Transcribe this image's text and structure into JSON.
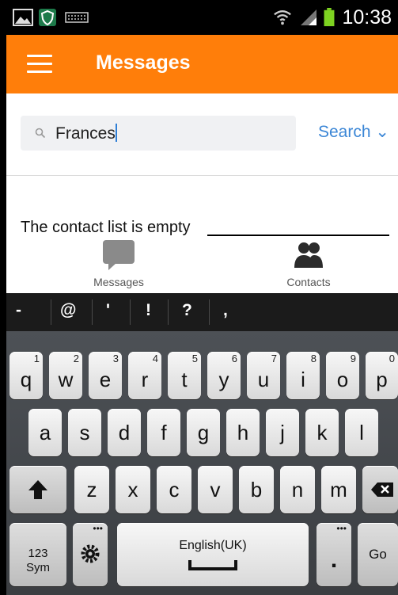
{
  "status_bar": {
    "time": "10:38",
    "icons": [
      "gallery-icon",
      "shield-icon",
      "keyboard-icon",
      "wifi-icon",
      "signal-icon",
      "battery-icon"
    ]
  },
  "app_bar": {
    "title": "Messages",
    "menu_icon": "hamburger-menu-icon",
    "color": "#ff7e0a"
  },
  "search": {
    "value": "Frances",
    "button_label": "Search",
    "icon": "search-icon"
  },
  "contacts": {
    "empty_message": "The contact list is empty"
  },
  "bottom_nav": {
    "items": [
      {
        "label": "Messages",
        "icon": "chat-bubble-icon"
      },
      {
        "label": "Contacts",
        "icon": "people-icon"
      }
    ]
  },
  "keyboard": {
    "suggestions": [
      "-",
      "@",
      "'",
      "!",
      "?",
      ","
    ],
    "row1": [
      {
        "char": "q",
        "hint": "1"
      },
      {
        "char": "w",
        "hint": "2"
      },
      {
        "char": "e",
        "hint": "3"
      },
      {
        "char": "r",
        "hint": "4"
      },
      {
        "char": "t",
        "hint": "5"
      },
      {
        "char": "y",
        "hint": "6"
      },
      {
        "char": "u",
        "hint": "7"
      },
      {
        "char": "i",
        "hint": "8"
      },
      {
        "char": "o",
        "hint": "9"
      },
      {
        "char": "p",
        "hint": "0"
      }
    ],
    "row2": [
      "a",
      "s",
      "d",
      "f",
      "g",
      "h",
      "j",
      "k",
      "l"
    ],
    "row3": [
      "z",
      "x",
      "c",
      "v",
      "b",
      "n",
      "m"
    ],
    "sym_label_top": "123",
    "sym_label_bottom": "Sym",
    "space_label": "English(UK)",
    "period_label": ".",
    "go_label": "Go"
  }
}
